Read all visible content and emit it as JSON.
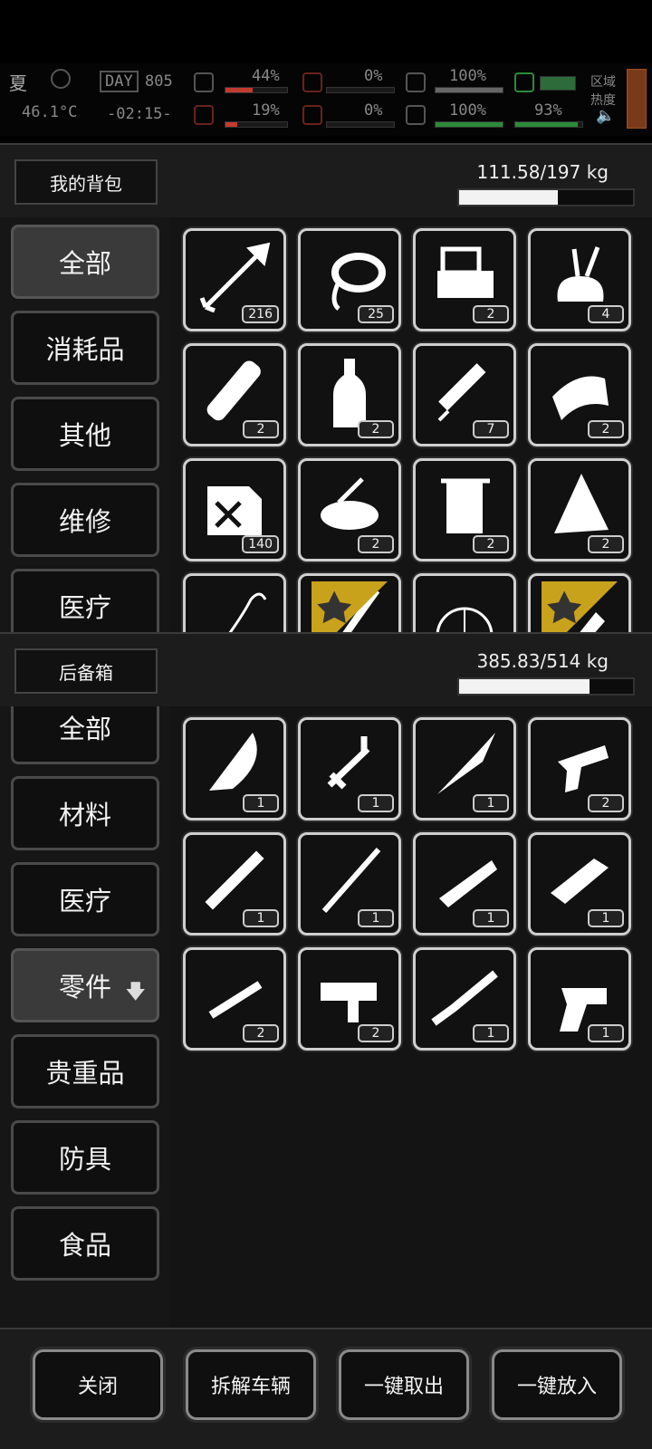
{
  "hud": {
    "season": "夏",
    "temperature": "46.1°C",
    "day_label": "DAY",
    "day_number": "805",
    "clock": "-02:15-",
    "stats": [
      {
        "value": "44%",
        "color": "#c23b2f",
        "fill": 0.44
      },
      {
        "value": "19%",
        "color": "#c23b2f",
        "fill": 0.19
      },
      {
        "value": "0%",
        "color": "#c23b2f",
        "fill": 0
      },
      {
        "value": "0%",
        "color": "#c23b2f",
        "fill": 0
      },
      {
        "value": "100%",
        "color": "#8a8a8a",
        "fill": 1
      },
      {
        "value": "100%",
        "color": "#2d8a3a",
        "fill": 1
      },
      {
        "value": "93%",
        "color": "#2d8a3a",
        "fill": 0.93
      }
    ],
    "zone_label_1": "区域",
    "zone_label_2": "热度"
  },
  "backpack": {
    "title": "我的背包",
    "weight": "111.58/197 kg",
    "weight_fill": 0.566,
    "categories": [
      "全部",
      "消耗品",
      "其他",
      "维修",
      "医疗"
    ],
    "selected": 0,
    "items": [
      {
        "icon": "arrow-icon",
        "count": "216"
      },
      {
        "icon": "rope-icon",
        "count": "25"
      },
      {
        "icon": "toolbox-icon",
        "count": "2"
      },
      {
        "icon": "tool-bag-icon",
        "count": "4"
      },
      {
        "icon": "bandage-roll-icon",
        "count": "2"
      },
      {
        "icon": "bottle-icon",
        "count": "2"
      },
      {
        "icon": "syringe-icon",
        "count": "7"
      },
      {
        "icon": "cloth-roll-icon",
        "count": "2"
      },
      {
        "icon": "fuel-can-icon",
        "count": "140"
      },
      {
        "icon": "food-bowl-icon",
        "count": "2"
      },
      {
        "icon": "towel-icon",
        "count": "2"
      },
      {
        "icon": "torn-cloth-icon",
        "count": "2"
      },
      {
        "icon": "wire-icon",
        "count": ""
      },
      {
        "icon": "blade-icon",
        "count": "",
        "starred": true
      },
      {
        "icon": "net-ball-icon",
        "count": ""
      },
      {
        "icon": "multitool-icon",
        "count": "",
        "starred": true
      }
    ]
  },
  "storage": {
    "title": "后备箱",
    "weight": "385.83/514 kg",
    "weight_fill": 0.751,
    "categories": [
      "全部",
      "材料",
      "医疗",
      "零件",
      "贵重品",
      "防具",
      "食品"
    ],
    "selected": 3,
    "selected_arrow": "🡇",
    "items": [
      {
        "icon": "knife-blade-icon",
        "count": "1"
      },
      {
        "icon": "gun-bolt-icon",
        "count": "1"
      },
      {
        "icon": "spearhead-icon",
        "count": "1"
      },
      {
        "icon": "pistol-frame-icon",
        "count": "2"
      },
      {
        "icon": "scope-icon",
        "count": "1"
      },
      {
        "icon": "gun-barrel-icon",
        "count": "1"
      },
      {
        "icon": "rifle-receiver-icon",
        "count": "1"
      },
      {
        "icon": "handguard-icon",
        "count": "1"
      },
      {
        "icon": "short-barrel-icon",
        "count": "2"
      },
      {
        "icon": "trigger-assembly-icon",
        "count": "2"
      },
      {
        "icon": "shotgun-icon",
        "count": "1"
      },
      {
        "icon": "revolver-frame-icon",
        "count": "1"
      }
    ]
  },
  "actions": {
    "close": "关闭",
    "dismantle": "拆解车辆",
    "take_all": "一键取出",
    "put_all": "一键放入"
  }
}
